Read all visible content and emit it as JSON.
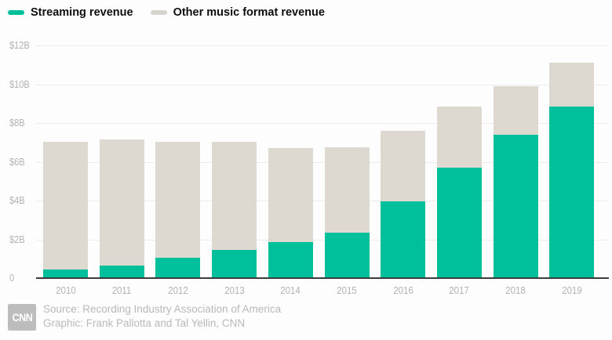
{
  "legend": {
    "items": [
      {
        "name": "streaming",
        "label": "Streaming revenue",
        "color": "#00bf9b"
      },
      {
        "name": "other",
        "label": "Other music format revenue",
        "color": "#d7d4ce"
      }
    ]
  },
  "chart_data": {
    "type": "bar",
    "stacked": true,
    "title": "",
    "xlabel": "",
    "ylabel": "",
    "unit": "billions of US dollars",
    "categories": [
      "2010",
      "2011",
      "2012",
      "2013",
      "2014",
      "2015",
      "2016",
      "2017",
      "2018",
      "2019"
    ],
    "series": [
      {
        "name": "Streaming revenue",
        "color": "#00bf9b",
        "values": [
          0.45,
          0.65,
          1.05,
          1.45,
          1.85,
          2.35,
          3.95,
          5.7,
          7.4,
          8.85
        ]
      },
      {
        "name": "Other music format revenue",
        "color": "#ddd9d1",
        "values": [
          6.6,
          6.5,
          6.0,
          5.6,
          4.85,
          4.4,
          3.65,
          3.15,
          2.5,
          2.25
        ]
      }
    ],
    "totals": [
      7.05,
      7.15,
      7.05,
      7.05,
      6.7,
      6.75,
      7.6,
      8.85,
      9.9,
      11.1
    ],
    "ylim": [
      0,
      12
    ],
    "yticks": [
      {
        "value": 12,
        "label": "$12B"
      },
      {
        "value": 10,
        "label": "$10B"
      },
      {
        "value": 8,
        "label": "$8B"
      },
      {
        "value": 6,
        "label": "$6B"
      },
      {
        "value": 4,
        "label": "$4B"
      },
      {
        "value": 2,
        "label": "$2B"
      },
      {
        "value": 0,
        "label": "0"
      }
    ],
    "grid": true,
    "legend_position": "top-left"
  },
  "footer": {
    "logo_text": "CNN",
    "source_line": "Source: Recording Industry Association of America",
    "credit_line": "Graphic: Frank Pallotta and Tal Yellin, CNN"
  }
}
